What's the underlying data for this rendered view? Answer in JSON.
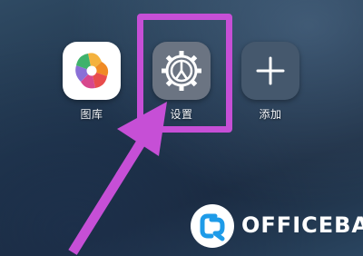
{
  "home_screen": {
    "apps": [
      {
        "label": "图库",
        "icon": "gallery-pinwheel-icon"
      },
      {
        "label": "设置",
        "icon": "gear-icon"
      },
      {
        "label": "添加",
        "icon": "plus-icon"
      }
    ]
  },
  "annotation": {
    "highlight_color": "#c64fd6",
    "target": "设置"
  },
  "watermark": {
    "text": "OFFICEBA",
    "logo_color": "#1e9be8"
  }
}
